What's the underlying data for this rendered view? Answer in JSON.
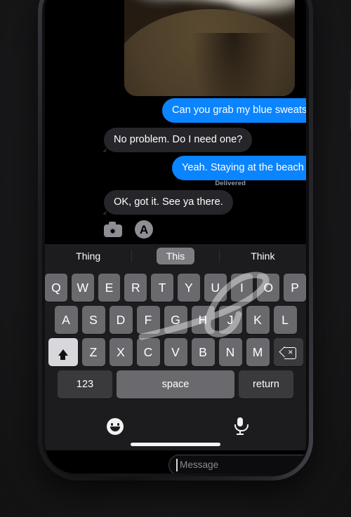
{
  "device": {
    "name": "smartphone",
    "side_buttons": [
      "mute-switch",
      "volume-up",
      "volume-down",
      "power-button"
    ]
  },
  "conversation": {
    "attachment": {
      "type": "photo",
      "description": "hill-at-dusk-photo"
    },
    "messages": [
      {
        "id": "m1",
        "text": "Can you grab my blue sweatshirt?",
        "side": "sent"
      },
      {
        "id": "m2",
        "text": "No problem. Do I need one?",
        "side": "received"
      },
      {
        "id": "m3",
        "text": "Yeah. Staying at the beach late.",
        "side": "sent"
      },
      {
        "id": "m4",
        "text": "OK, got it. See ya there.",
        "side": "received"
      }
    ],
    "status": "Delivered"
  },
  "input_bar": {
    "camera_icon": "camera-icon",
    "appstore_icon": "app-store-icon",
    "appstore_glyph": "A",
    "placeholder": "Message",
    "value": "",
    "mic_icon": "microphone-icon"
  },
  "keyboard": {
    "predictive": [
      {
        "word": "Thing",
        "selected": false
      },
      {
        "word": "This",
        "selected": true
      },
      {
        "word": "Think",
        "selected": false
      }
    ],
    "row1": [
      "Q",
      "W",
      "E",
      "R",
      "T",
      "Y",
      "U",
      "I",
      "O",
      "P"
    ],
    "row2": [
      "A",
      "S",
      "D",
      "F",
      "G",
      "H",
      "J",
      "K",
      "L"
    ],
    "row3": [
      "Z",
      "X",
      "C",
      "V",
      "B",
      "N",
      "M"
    ],
    "shift_icon": "shift-arrow-icon",
    "shift_state": "active",
    "backspace_icon": "backspace-icon",
    "numbers_key": "123",
    "space_key": "space",
    "return_key": "return",
    "swipe_trail": "swipe-typing-gesture-trail"
  },
  "bottom_bar": {
    "emoji_icon": "emoji-smiley-icon",
    "dictation_icon": "dictation-microphone-icon",
    "home_indicator": "home-indicator"
  },
  "colors": {
    "sent_bubble": "#0b84ff",
    "received_bubble": "#26262a",
    "keyboard_bg": "#1c1c1e",
    "key": "#6a6a6e",
    "key_dark": "#3a3a3c",
    "shift_active": "#d8d8dc",
    "text": "#ffffff",
    "placeholder": "#8a8a8f",
    "delivered": "#9a9a9f"
  }
}
